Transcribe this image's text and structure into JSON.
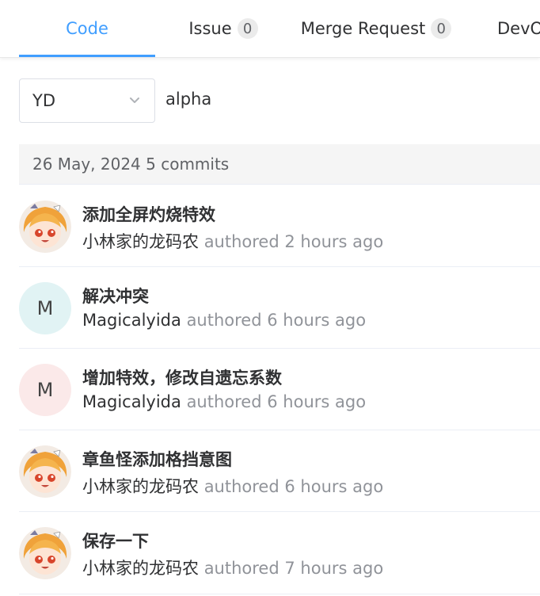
{
  "tabs": [
    {
      "label": "Code",
      "active": true
    },
    {
      "label": "Issue",
      "count": "0"
    },
    {
      "label": "Merge Request",
      "count": "0"
    },
    {
      "label": "DevOps"
    }
  ],
  "branch": {
    "selected": "YD",
    "name": "alpha",
    "icon": "chevron-down-icon"
  },
  "date_group": {
    "label": "26 May, 2024 5 commits"
  },
  "commits": [
    {
      "title": "添加全屏灼烧特效",
      "author": "小林家的龙码农",
      "action": "authored",
      "time": "2 hours ago",
      "avatar_initial": ""
    },
    {
      "title": "解决冲突",
      "author": "Magicalyida",
      "action": "authored",
      "time": "6 hours ago",
      "avatar_initial": "M"
    },
    {
      "title": "增加特效，修改自遗忘系数",
      "author": "Magicalyida",
      "action": "authored",
      "time": "6 hours ago",
      "avatar_initial": "M"
    },
    {
      "title": "章鱼怪添加格挡意图",
      "author": "小林家的龙码农",
      "action": "authored",
      "time": "6 hours ago",
      "avatar_initial": ""
    },
    {
      "title": "保存一下",
      "author": "小林家的龙码农",
      "action": "authored",
      "time": "7 hours ago",
      "avatar_initial": ""
    }
  ],
  "colors": {
    "accent": "#409eff",
    "teal_avatar": "#e1f3f4",
    "pink_avatar": "#fbe9e9"
  }
}
